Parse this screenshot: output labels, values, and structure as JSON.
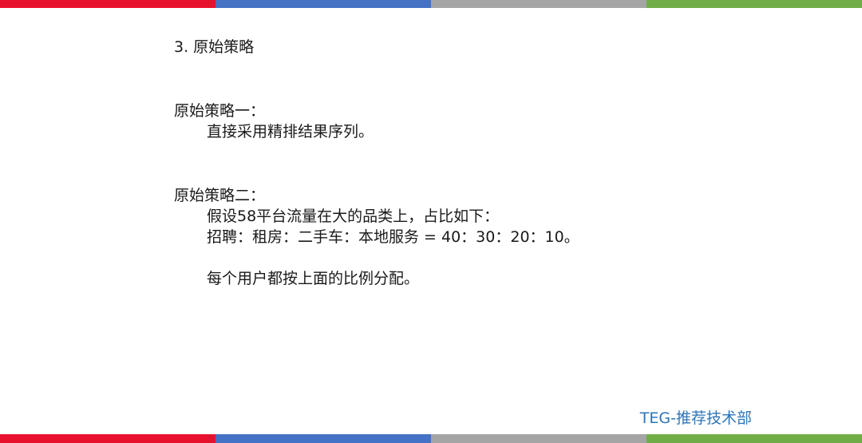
{
  "slide": {
    "section_title": "3. 原始策略",
    "strategy_one": {
      "heading": "原始策略一：",
      "body": "直接采用精排结果序列。"
    },
    "strategy_two": {
      "heading": "原始策略二：",
      "line1": "假设58平台流量在大的品类上，占比如下：",
      "line2": "招聘：租房：二手车：本地服务 = 40：30：20：10。",
      "line3": "每个用户都按上面的比例分配。"
    },
    "brand": "TEG-推荐技术部"
  },
  "colors": {
    "stripe": [
      "#e8112d",
      "#4472c4",
      "#a5a5a5",
      "#70ad47"
    ],
    "brand": "#2e75b6"
  }
}
